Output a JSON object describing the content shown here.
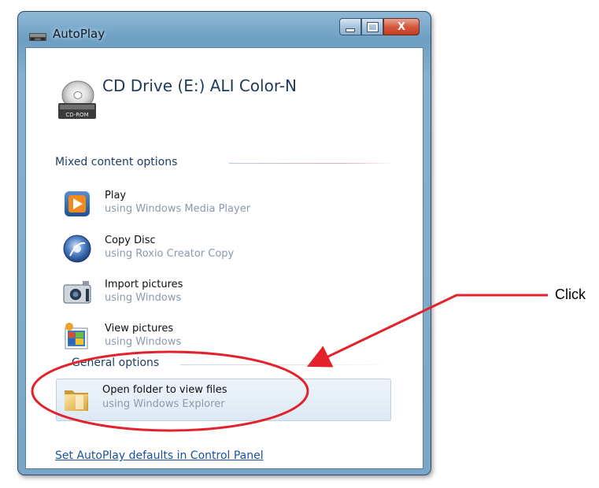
{
  "window": {
    "title": "AutoPlay",
    "controls": [
      "minimize-icon",
      "maximize-icon",
      "close-icon"
    ],
    "close_glyph": "X"
  },
  "device": {
    "title": "CD Drive (E:) ALI Color-N",
    "icon_label": "CD-ROM",
    "icon": "cd-rom-icon"
  },
  "sections": {
    "mixed": "Mixed content options",
    "general": "General options"
  },
  "options": [
    {
      "title": "Play",
      "subtitle": "using Windows Media Player",
      "icon": "media-player-icon"
    },
    {
      "title": "Copy Disc",
      "subtitle": "using Roxio Creator Copy",
      "icon": "roxio-disc-icon"
    },
    {
      "title": "Import pictures",
      "subtitle": "using Windows",
      "icon": "camera-import-icon"
    },
    {
      "title": "View pictures",
      "subtitle": "using Windows",
      "icon": "picture-viewer-icon"
    }
  ],
  "general_options": [
    {
      "title": "Open folder to view files",
      "subtitle": "using Windows Explorer",
      "icon": "folder-icon"
    }
  ],
  "footer_link": "Set AutoPlay defaults in Control Panel",
  "annotation": {
    "text": "Click",
    "color": "#e3222b"
  }
}
